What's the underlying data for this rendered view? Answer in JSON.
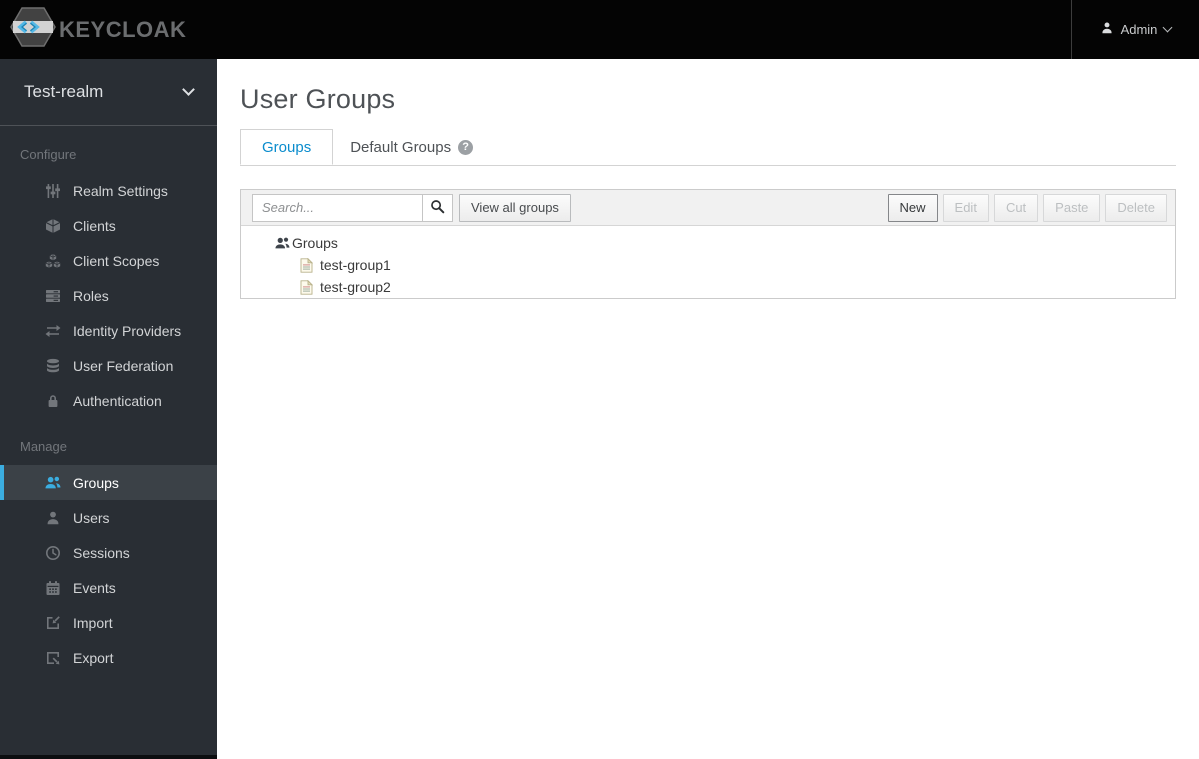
{
  "header": {
    "brand": "KEYCLOAK",
    "user_label": "Admin"
  },
  "sidebar": {
    "realm_selector": {
      "label": "Test-realm"
    },
    "sections": [
      {
        "label": "Configure",
        "items": [
          {
            "label": "Realm Settings",
            "icon": "sliders-icon"
          },
          {
            "label": "Clients",
            "icon": "cube-icon"
          },
          {
            "label": "Client Scopes",
            "icon": "cubes-icon"
          },
          {
            "label": "Roles",
            "icon": "tasks-icon"
          },
          {
            "label": "Identity Providers",
            "icon": "exchange-icon"
          },
          {
            "label": "User Federation",
            "icon": "database-icon"
          },
          {
            "label": "Authentication",
            "icon": "lock-icon"
          }
        ]
      },
      {
        "label": "Manage",
        "items": [
          {
            "label": "Groups",
            "icon": "users-icon",
            "active": true
          },
          {
            "label": "Users",
            "icon": "user-icon",
            "active": false
          },
          {
            "label": "Sessions",
            "icon": "clock-icon",
            "active": false
          },
          {
            "label": "Events",
            "icon": "calendar-icon",
            "active": false
          },
          {
            "label": "Import",
            "icon": "import-icon",
            "active": false
          },
          {
            "label": "Export",
            "icon": "export-icon",
            "active": false
          }
        ]
      }
    ]
  },
  "main": {
    "title": "User Groups",
    "tabs": [
      {
        "label": "Groups",
        "active": true
      },
      {
        "label": "Default Groups",
        "active": false,
        "has_help_icon": true
      }
    ],
    "toolbar": {
      "search_placeholder": "Search...",
      "search_value": "",
      "view_all_label": "View all groups",
      "actions": [
        {
          "label": "New",
          "enabled": true
        },
        {
          "label": "Edit",
          "enabled": false
        },
        {
          "label": "Cut",
          "enabled": false
        },
        {
          "label": "Paste",
          "enabled": false
        },
        {
          "label": "Delete",
          "enabled": false
        }
      ]
    },
    "tree": {
      "root_label": "Groups",
      "children": [
        {
          "label": "test-group1"
        },
        {
          "label": "test-group2"
        }
      ]
    }
  },
  "colors": {
    "topbar_bg": "#040404",
    "sidebar_bg": "#292e34",
    "sidebar_active_bg": "#3b4147",
    "sidebar_accent_blue": "#3bade0",
    "tab_active_blue": "#0a8ccd",
    "toolbar_bg": "#f1f1f1"
  },
  "help_icon_glyph": "?"
}
